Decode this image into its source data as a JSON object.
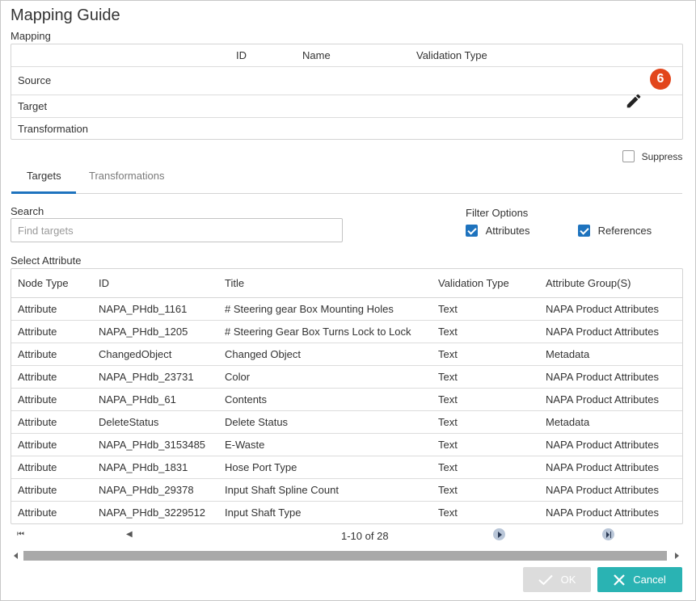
{
  "dialog": {
    "title": "Mapping Guide"
  },
  "mapping_section": {
    "label": "Mapping"
  },
  "mapping_table": {
    "headers": [
      "ID",
      "Name",
      "Validation Type"
    ],
    "rows": [
      "Source",
      "Target",
      "Transformation"
    ]
  },
  "badge": {
    "value": "6"
  },
  "suppress": {
    "label": "Suppress",
    "checked": false
  },
  "tabs": [
    {
      "label": "Targets",
      "active": true
    },
    {
      "label": "Transformations",
      "active": false
    }
  ],
  "search": {
    "label": "Search",
    "placeholder": "Find targets",
    "value": ""
  },
  "filter": {
    "label": "Filter Options",
    "attributes_label": "Attributes",
    "attributes_checked": true,
    "references_label": "References",
    "references_checked": true
  },
  "attribute_section": {
    "label": "Select Attribute"
  },
  "attribute_table": {
    "headers": [
      "Node Type",
      "ID",
      "Title",
      "Validation Type",
      "Attribute Group(S)"
    ],
    "rows": [
      [
        "Attribute",
        "NAPA_PHdb_1161",
        "# Steering gear Box Mounting Holes",
        "Text",
        "NAPA Product Attributes"
      ],
      [
        "Attribute",
        "NAPA_PHdb_1205",
        "# Steering Gear Box Turns Lock to Lock",
        "Text",
        "NAPA Product Attributes"
      ],
      [
        "Attribute",
        "ChangedObject",
        "Changed Object",
        "Text",
        "Metadata"
      ],
      [
        "Attribute",
        "NAPA_PHdb_23731",
        "Color",
        "Text",
        "NAPA Product Attributes"
      ],
      [
        "Attribute",
        "NAPA_PHdb_61",
        "Contents",
        "Text",
        "NAPA Product Attributes"
      ],
      [
        "Attribute",
        "DeleteStatus",
        "Delete Status",
        "Text",
        "Metadata"
      ],
      [
        "Attribute",
        "NAPA_PHdb_3153485",
        "E-Waste",
        "Text",
        "NAPA Product Attributes"
      ],
      [
        "Attribute",
        "NAPA_PHdb_1831",
        "Hose Port Type",
        "Text",
        "NAPA Product Attributes"
      ],
      [
        "Attribute",
        "NAPA_PHdb_29378",
        "Input Shaft Spline Count",
        "Text",
        "NAPA Product Attributes"
      ],
      [
        "Attribute",
        "NAPA_PHdb_3229512",
        "Input Shaft Type",
        "Text",
        "NAPA Product Attributes"
      ]
    ]
  },
  "pager": {
    "info": "1-10 of 28"
  },
  "buttons": {
    "ok": "OK",
    "cancel": "Cancel"
  },
  "colors": {
    "accent": "#1e73be",
    "badge": "#e2461c",
    "cancel": "#2ab3b3",
    "ok_disabled": "#dcdcdc"
  }
}
